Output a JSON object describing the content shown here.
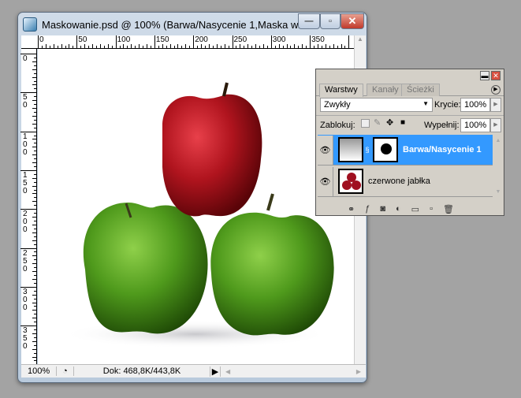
{
  "document_window": {
    "title": "Maskowanie.psd @ 100% (Barwa/Nasycenie 1,Maska w...",
    "controls": {
      "minimize": "—",
      "maximize": "▫",
      "close": "✕"
    },
    "ruler_top_labels": [
      "0",
      "50",
      "100",
      "150",
      "200",
      "250",
      "300",
      "350"
    ],
    "ruler_left_labels": [
      "0",
      "50",
      "100",
      "150",
      "200",
      "250",
      "300",
      "350"
    ],
    "status": {
      "zoom": "100%",
      "doc_info": "Dok: 468,8K/443,8K"
    }
  },
  "layers_panel": {
    "tabs": [
      {
        "label": "Warstwy",
        "active": true
      },
      {
        "label": "Kanały",
        "active": false
      },
      {
        "label": "Ścieżki",
        "active": false
      }
    ],
    "blend_mode": "Zwykły",
    "opacity_label": "Krycie:",
    "opacity_value": "100%",
    "lock_label": "Zablokuj:",
    "fill_label": "Wypełnij:",
    "fill_value": "100%",
    "layers": [
      {
        "name": "Barwa/Nasycenie 1",
        "selected": true
      },
      {
        "name": "czerwone jabłka",
        "selected": false
      }
    ],
    "selection_color": "#3399ff"
  }
}
